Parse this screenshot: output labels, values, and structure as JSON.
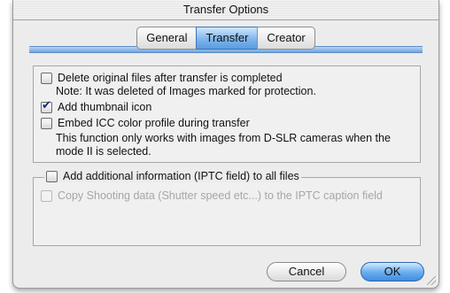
{
  "window": {
    "title": "Transfer Options"
  },
  "tabs": [
    {
      "label": "General",
      "active": false
    },
    {
      "label": "Transfer",
      "active": true
    },
    {
      "label": "Creator",
      "active": false
    }
  ],
  "options": {
    "delete_original": {
      "label": "Delete original files after transfer is completed",
      "checked": false
    },
    "delete_note": "Note: It was deleted of Images marked for protection.",
    "add_thumbnail": {
      "label": "Add thumbnail icon",
      "checked": true
    },
    "embed_icc": {
      "label": "Embed ICC color profile during transfer",
      "checked": false
    },
    "icc_note_line1": "This function only works with images from D-SLR cameras when the",
    "icc_note_line2": "mode II is selected."
  },
  "iptc": {
    "add_info": {
      "label": "Add additional information (IPTC field) to all files",
      "checked": false
    },
    "copy_shooting": {
      "label": "Copy Shooting data (Shutter speed etc...)  to the IPTC caption field",
      "checked": false,
      "enabled": false
    }
  },
  "buttons": {
    "cancel": "Cancel",
    "ok": "OK"
  },
  "colors": {
    "accent": "#6fa3dc",
    "default_button": "#3e8de0"
  }
}
